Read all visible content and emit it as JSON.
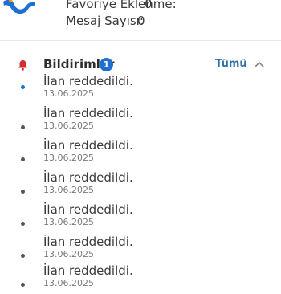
{
  "stats": {
    "favorites_label": "Favoriye Eklenme:",
    "favorites_value": "0",
    "messages_label": "Mesaj Sayısı:",
    "messages_value": "0"
  },
  "notifications": {
    "title": "Bildirimler",
    "badge_count": "1",
    "see_all_label": "Tümü",
    "items": [
      {
        "text": "İlan reddedildi.",
        "date": "13.06.2025",
        "unread": true
      },
      {
        "text": "İlan reddedildi.",
        "date": "13.06.2025",
        "unread": false
      },
      {
        "text": "İlan reddedildi.",
        "date": "13.06.2025",
        "unread": false
      },
      {
        "text": "İlan reddedildi.",
        "date": "13.06.2025",
        "unread": false
      },
      {
        "text": "İlan reddedildi.",
        "date": "13.06.2025",
        "unread": false
      },
      {
        "text": "İlan reddedildi.",
        "date": "13.06.2025",
        "unread": false
      },
      {
        "text": "İlan reddedildi.",
        "date": "13.06.2025",
        "unread": false
      }
    ]
  },
  "colors": {
    "accent": "#1f6fd1",
    "link": "#2f6fa6",
    "bell": "#d32f2f"
  },
  "icons": {
    "brand": "brand-logo-icon",
    "bell": "bell-icon",
    "collapse": "chevron-up-icon",
    "unread": "unread-dot-icon",
    "read": "read-dot-icon"
  }
}
